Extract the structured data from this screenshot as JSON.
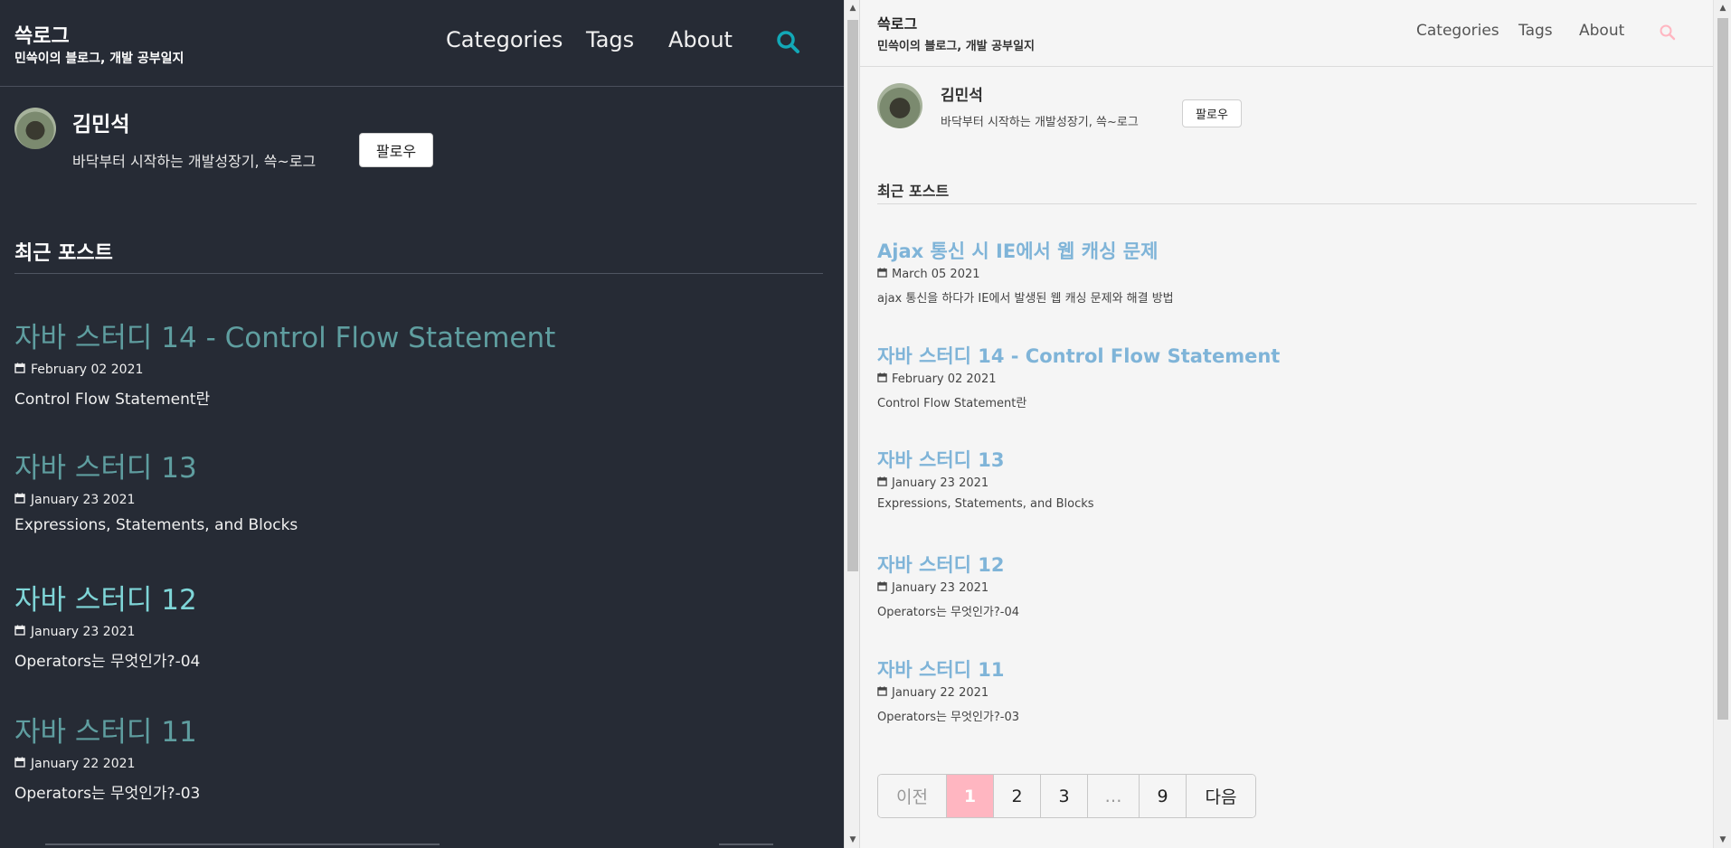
{
  "dark": {
    "site_title": "쓱로그",
    "site_subtitle": "민쓱이의 블로그, 개발 공부일지",
    "nav": [
      "Categories",
      "Tags",
      "About"
    ],
    "search_icon": "search-icon",
    "accent": "#12a8b7",
    "author": {
      "name": "김민석",
      "bio": "바닥부터 시작하는 개발성장기, 쓱~로그",
      "follow_label": "팔로우"
    },
    "section_title": "최근 포스트",
    "posts": [
      {
        "title": "자바 스터디 14 - Control Flow Statement",
        "date": "February 02 2021",
        "desc": "Control Flow Statement란"
      },
      {
        "title": "자바 스터디 13",
        "date": "January 23 2021",
        "desc": "Expressions, Statements, and Blocks"
      },
      {
        "title": "자바 스터디 12",
        "date": "January 23 2021",
        "desc": "Operators는 무엇인가?-04"
      },
      {
        "title": "자바 스터디 11",
        "date": "January 22 2021",
        "desc": "Operators는 무엇인가?-03"
      }
    ]
  },
  "light": {
    "site_title": "쓱로그",
    "site_subtitle": "민쓱이의 블로그, 개발 공부일지",
    "nav": [
      "Categories",
      "Tags",
      "About"
    ],
    "search_icon": "search-icon",
    "accent": "#ffb6c1",
    "author": {
      "name": "김민석",
      "bio": "바닥부터 시작하는 개발성장기, 쓱~로그",
      "follow_label": "팔로우"
    },
    "section_title": "최근 포스트",
    "posts": [
      {
        "title": "Ajax 통신 시 IE에서 웹 캐싱 문제",
        "date": "March 05 2021",
        "desc": "ajax 통신을 하다가 IE에서 발생된 웹 캐싱 문제와 해결 방법"
      },
      {
        "title": "자바 스터디 14 - Control Flow Statement",
        "date": "February 02 2021",
        "desc": "Control Flow Statement란"
      },
      {
        "title": "자바 스터디 13",
        "date": "January 23 2021",
        "desc": "Expressions, Statements, and Blocks"
      },
      {
        "title": "자바 스터디 12",
        "date": "January 23 2021",
        "desc": "Operators는 무엇인가?-04"
      },
      {
        "title": "자바 스터디 11",
        "date": "January 22 2021",
        "desc": "Operators는 무엇인가?-03"
      }
    ],
    "pagination": {
      "prev": "이전",
      "pages": [
        "1",
        "2",
        "3",
        "…",
        "9"
      ],
      "active": "1",
      "next": "다음"
    }
  }
}
